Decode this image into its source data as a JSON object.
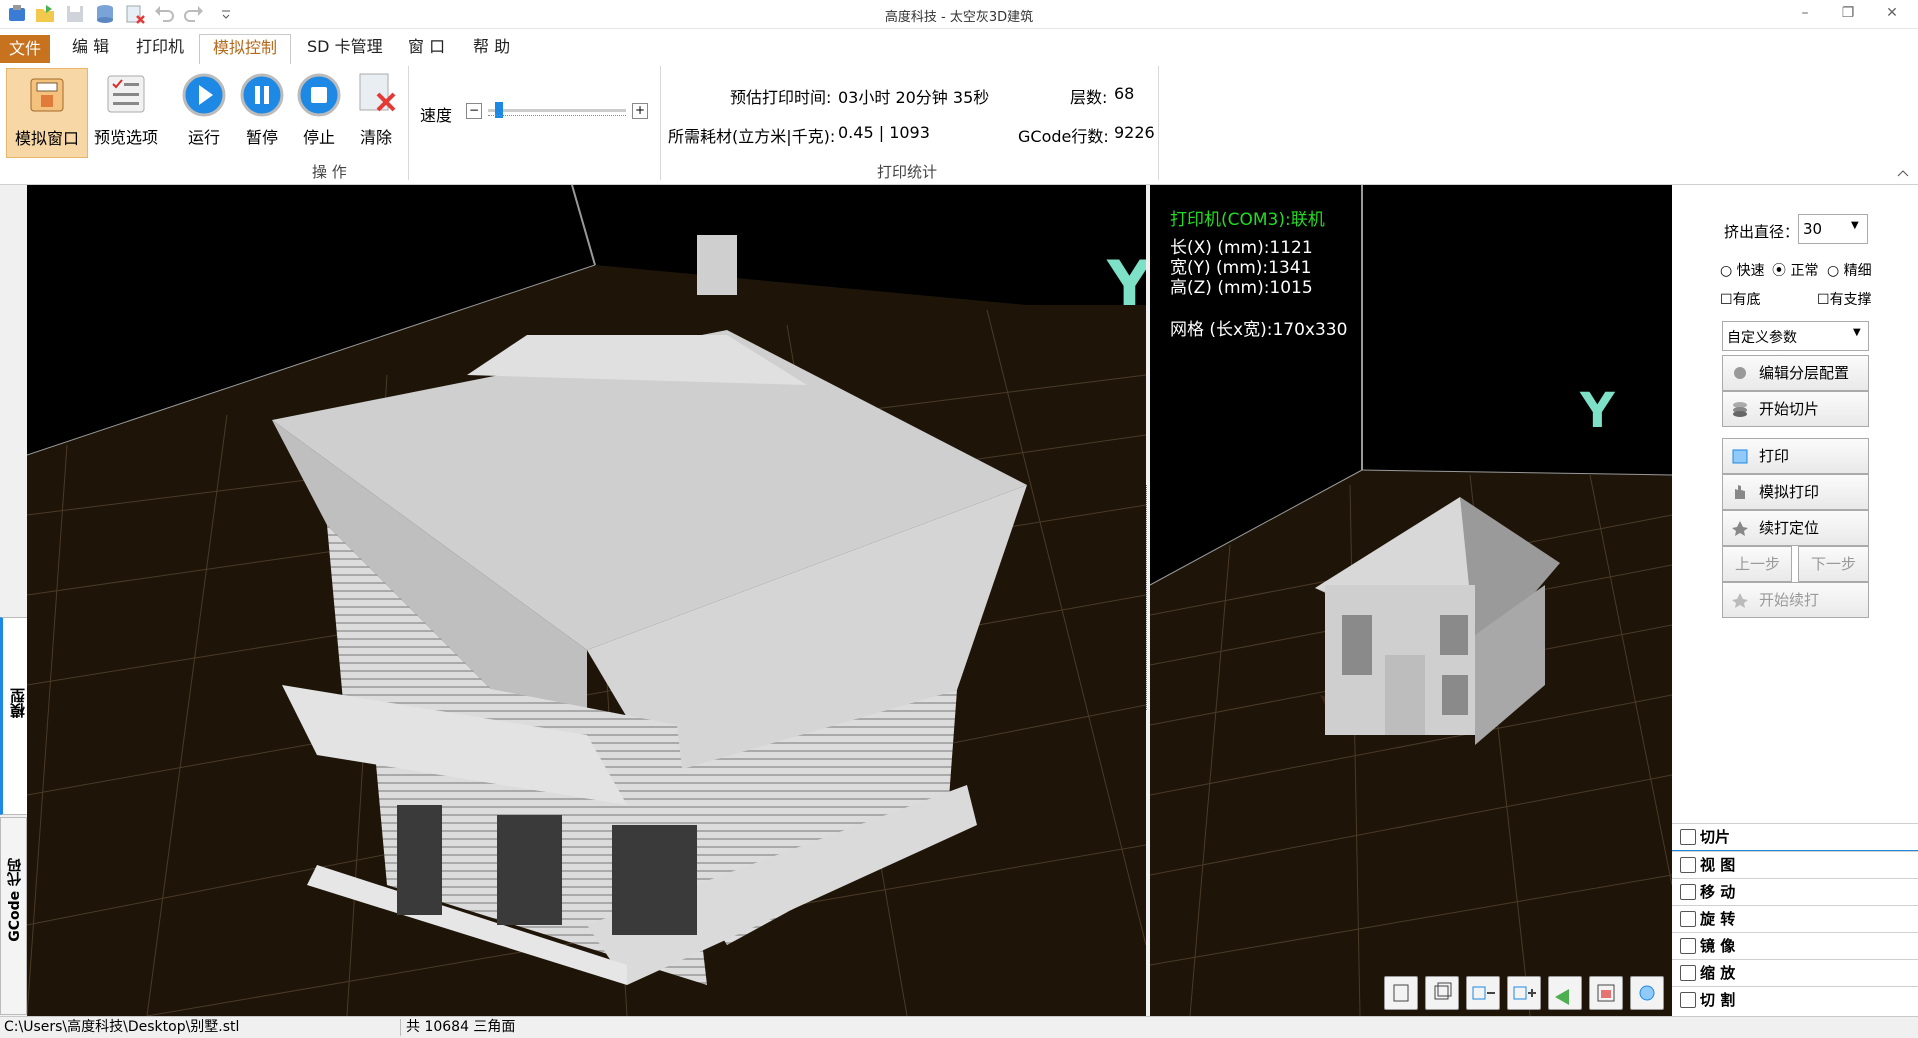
{
  "window": {
    "title": "高度科技 - 太空灰3D建筑"
  },
  "menu": {
    "file": "文件",
    "edit": "编 辑",
    "printer": "打印机",
    "sim_control": "模拟控制",
    "sd": "SD 卡管理",
    "window": "窗 口",
    "help": "帮 助"
  },
  "ribbon": {
    "sim_window": "模拟窗口",
    "preview_options": "预览选项",
    "run": "运行",
    "pause": "暂停",
    "stop": "停止",
    "clear": "清除",
    "speed_label": "速度",
    "speed_level": 0.05,
    "group_ops": "操 作",
    "group_stats": "打印统计",
    "est_time_label": "预估打印时间:",
    "est_time_value": "03小时 20分钟 35秒",
    "layers_label": "层数:",
    "layers_value": "68",
    "material_label": "所需耗材(立方米|千克):",
    "material_value": "0.45 | 1093",
    "gcode_lines_label": "GCode行数:",
    "gcode_lines_value": "9226"
  },
  "viewport_info": {
    "printer": "打印机(COM3):联机",
    "len_x": "长(X) (mm):1121",
    "wid_y": "宽(Y) (mm):1341",
    "hgt_z": "高(Z) (mm):1015",
    "grid": "网格 (长x宽):170x330",
    "axis_y": "Y"
  },
  "side_tabs": {
    "model": "模型",
    "gcode": "GCode 代码"
  },
  "right_panel": {
    "extrude_label": "挤出直径：",
    "extrude_value": "30",
    "q_fast": "快速",
    "q_normal": "正常",
    "q_fine": "精细",
    "has_base": "有底",
    "has_support": "有支撑",
    "custom_params": "自定义参数",
    "edit_layer_config": "编辑分层配置",
    "start_slice": "开始切片",
    "print": "打印",
    "sim_print": "模拟打印",
    "resume_locate": "续打定位",
    "prev_step": "上一步",
    "next_step": "下一步",
    "start_resume": "开始续打",
    "acc_slice": "切片",
    "acc_view": "视 图",
    "acc_move": "移 动",
    "acc_rotate": "旋 转",
    "acc_mirror": "镜 像",
    "acc_scale": "缩 放",
    "acc_cut": "切 割"
  },
  "status": {
    "path": "C:\\Users\\高度科技\\Desktop\\别墅.stl",
    "triangles": "共 10684 三角面"
  },
  "colors": {
    "accent": "#c7721e",
    "viewport_bg": "#1e1508",
    "grid": "#4a3a28",
    "model": "#d8d8d8",
    "axis": "#7fe0c8",
    "green_text": "#22dd22"
  }
}
